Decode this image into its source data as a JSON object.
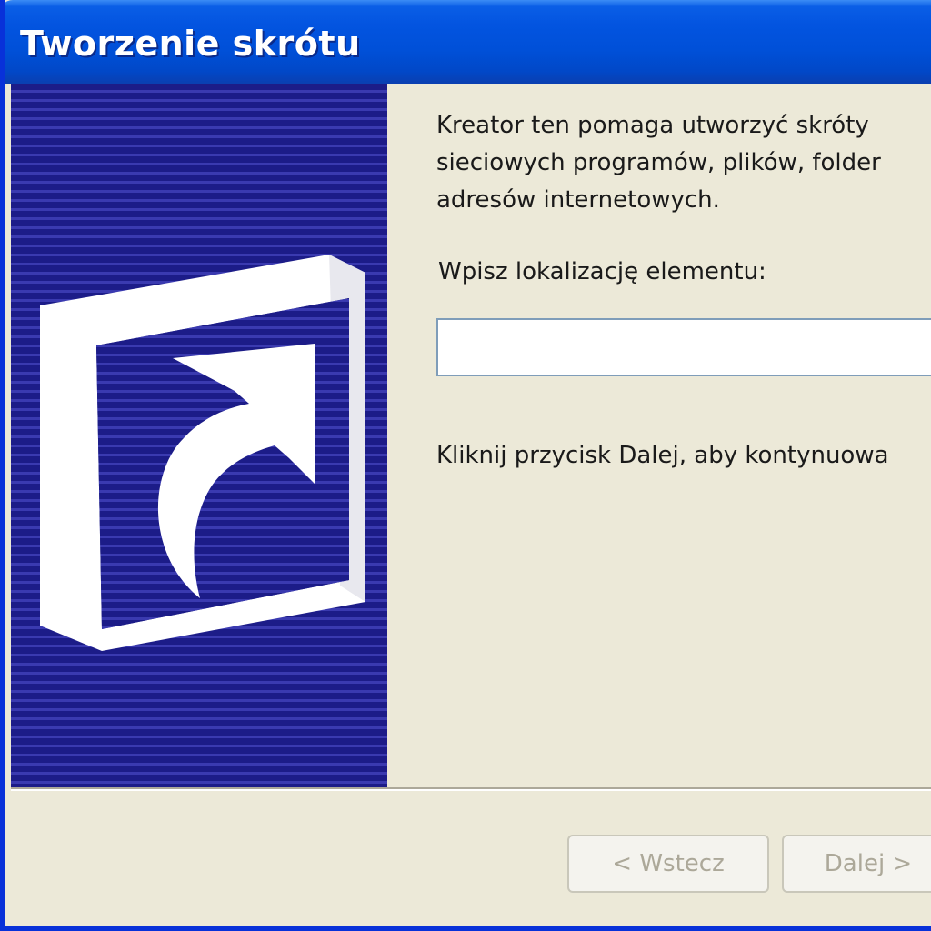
{
  "window": {
    "title": "Tworzenie skrótu"
  },
  "content": {
    "intro_text": "Kreator ten pomaga utworzyć skróty\nsieciowych programów, plików, folder\nadresów internetowych.",
    "location_label": "Wpisz lokalizację elementu:",
    "location_value": "",
    "hint_text": "Kliknij przycisk Dalej, aby kontynuowa"
  },
  "buttons": {
    "back_label": "< Wstecz",
    "next_label": "Dalej >"
  },
  "icons": {
    "side_graphic": "shortcut-arrow-icon"
  },
  "colors": {
    "title_bar": "#0054e3",
    "side_panel": "#1c1c88",
    "window_bg": "#ece9d8",
    "disabled_text": "#aca899"
  }
}
